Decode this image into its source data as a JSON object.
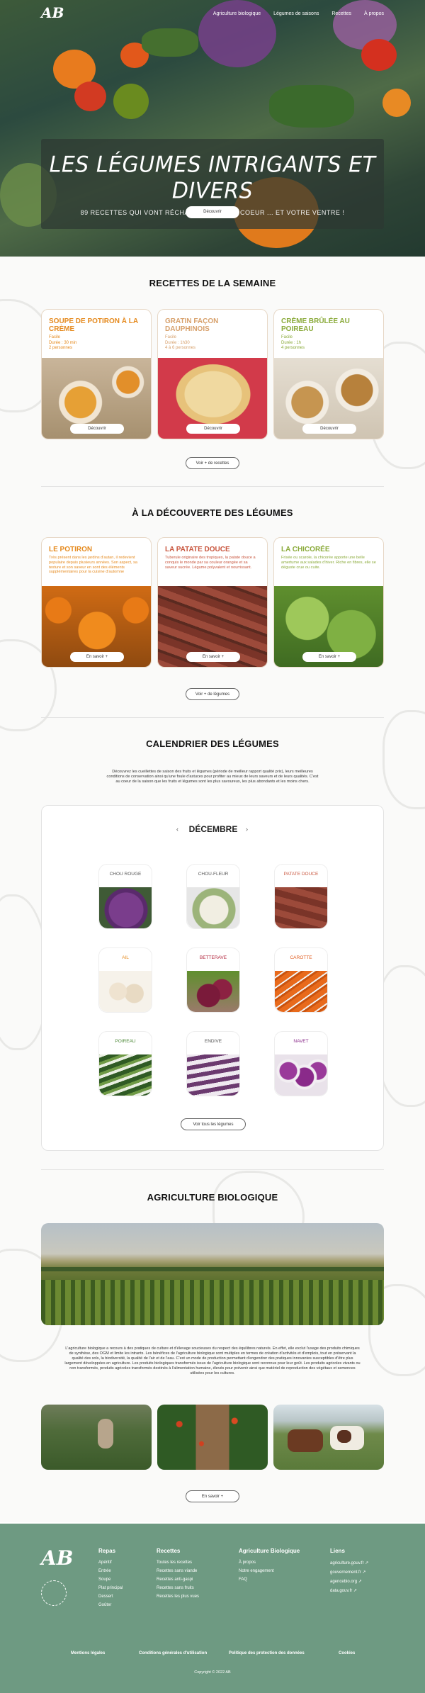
{
  "header": {
    "logo": "AB",
    "nav": [
      "Agriculture biologique",
      "Légumes de saisons",
      "Recettes",
      "À propos"
    ]
  },
  "hero": {
    "title": "Les légumes intrigants et divers",
    "subtitle": "89 recettes qui vont réchauffer votre coeur ... et votre ventre !",
    "button": "Découvrir"
  },
  "recipes": {
    "heading": "RECETTES DE LA SEMAINE",
    "items": [
      {
        "title": "Soupe de potiron à la crème",
        "meta": [
          "Facile",
          "Durée : 30 min",
          "2 personnes"
        ],
        "button": "Découvrir",
        "color": "#e58a1e"
      },
      {
        "title": "Gratin façon dauphinois",
        "meta": [
          "Facile",
          "Durée : 1h30",
          "4 à 6 personnes"
        ],
        "button": "Découvrir",
        "color": "#d7a06b"
      },
      {
        "title": "Crème brûlée au poireau",
        "meta": [
          "Facile",
          "Durée : 1h",
          "4 personnes"
        ],
        "button": "Découvrir",
        "color": "#8aaa3a"
      }
    ],
    "more": "Voir + de recettes"
  },
  "discover": {
    "heading": "À LA DÉCOUVERTE DES LÉGUMES",
    "items": [
      {
        "title": "Le potiron",
        "text": "Très présent dans les jardins d'autan, il redevient populaire depuis plusieurs années. Son aspect, sa texture et son saveur en sont des éléments supplémentaires pour la cuisine d'automne",
        "button": "En savoir +",
        "color": "#e58a1e"
      },
      {
        "title": "La patate douce",
        "text": "Tuberule originaire des tropiques, la patate douce a conquis le monde par sa couleur orangée et sa saveur sucrée. Légume polyvalent et nourrissant.",
        "button": "En savoir +",
        "color": "#c8553d"
      },
      {
        "title": "La chicorée",
        "text": "Frisée ou scarole, la chicorée apporte une belle amertume aux salades d'hiver. Riche en fibres, elle se déguste crue ou cuite.",
        "button": "En savoir +",
        "color": "#8aaa3a"
      }
    ],
    "more": "Voir + de légumes"
  },
  "calendar": {
    "heading": "CALENDRIER DES LÉGUMES",
    "intro": "Découvrez les cueillettes de saison des fruits et légumes (période de meilleur rapport qualité prix), leurs meilleures conditions de conservation ainsi qu'une foule d'astuces pour profiter au mieux de leurs saveurs et de leurs qualités. C'est au coeur de la saison que les fruits et légumes sont les plus savoureux, les plus abondants et les moins chers.",
    "month": "DÉCEMBRE",
    "prev": "‹",
    "next": "›",
    "vegetables": [
      {
        "name": "Chou rouge",
        "color": "#555"
      },
      {
        "name": "Chou-fleur",
        "color": "#555"
      },
      {
        "name": "Patate douce",
        "color": "#c8553d"
      },
      {
        "name": "Ail",
        "color": "#e58a1e"
      },
      {
        "name": "Betterave",
        "color": "#b2253c"
      },
      {
        "name": "Carotte",
        "color": "#e05a1c"
      },
      {
        "name": "Poireau",
        "color": "#4f8a3a"
      },
      {
        "name": "Endive",
        "color": "#555"
      },
      {
        "name": "Navet",
        "color": "#8a2a8a"
      }
    ],
    "more": "Voir tous les légumes"
  },
  "bio": {
    "heading": "AGRICULTURE BIOLOGIQUE",
    "text": "L'agriculture biologique a recours à des pratiques de culture et d'élevage soucieuses du respect des équilibres naturels. En effet, elle exclut l'usage des produits chimiques de synthèse, des OGM et limite les intrants. Les bénéfices de l'agriculture biologique sont multiples en termes de création d'activités et d'emplois, tout en préservant la qualité des sols, la biodiversité, la qualité de l'air et de l'eau. C'est un mode de production permettant d'engendrer des pratiques innovantes susceptibles d'être plus largement développées en agriculture. Les produits biologiques transformés issus de l'agriculture biologique sont reconnus pour leur goût. Les produits agricoles vivants ou non transformés, produits agricoles transformés destinés à l'alimentation humaine, élevés pour prévenir ainsi que matériel de reproduction des végétaux et semences utilisées pour les cultures.",
    "button": "En savoir +"
  },
  "footer": {
    "logo": "AB",
    "columns": [
      {
        "title": "Repas",
        "items": [
          "Apéritif",
          "Entrée",
          "Soupe",
          "Plat principal",
          "Dessert",
          "Goûter"
        ]
      },
      {
        "title": "Recettes",
        "items": [
          "Toutes les recettes",
          "Recettes sans viande",
          "Recettes anti-gaspi",
          "Recettes sans fruits",
          "Recettes les plus vues"
        ]
      },
      {
        "title": "Agriculture Biologique",
        "items": [
          "À propos",
          "Notre engagement",
          "FAQ"
        ]
      },
      {
        "title": "Liens",
        "items": [
          "agriculture.gouv.fr ↗",
          "gouvernement.fr ↗",
          "agencebio.org ↗",
          "data.gouv.fr ↗"
        ]
      }
    ],
    "bottom_links": [
      "Mentions légales",
      "Conditions générales d'utilisation",
      "Politique des protection des données",
      "Cookies"
    ],
    "copyright": "Copyright © 2022 AB"
  }
}
